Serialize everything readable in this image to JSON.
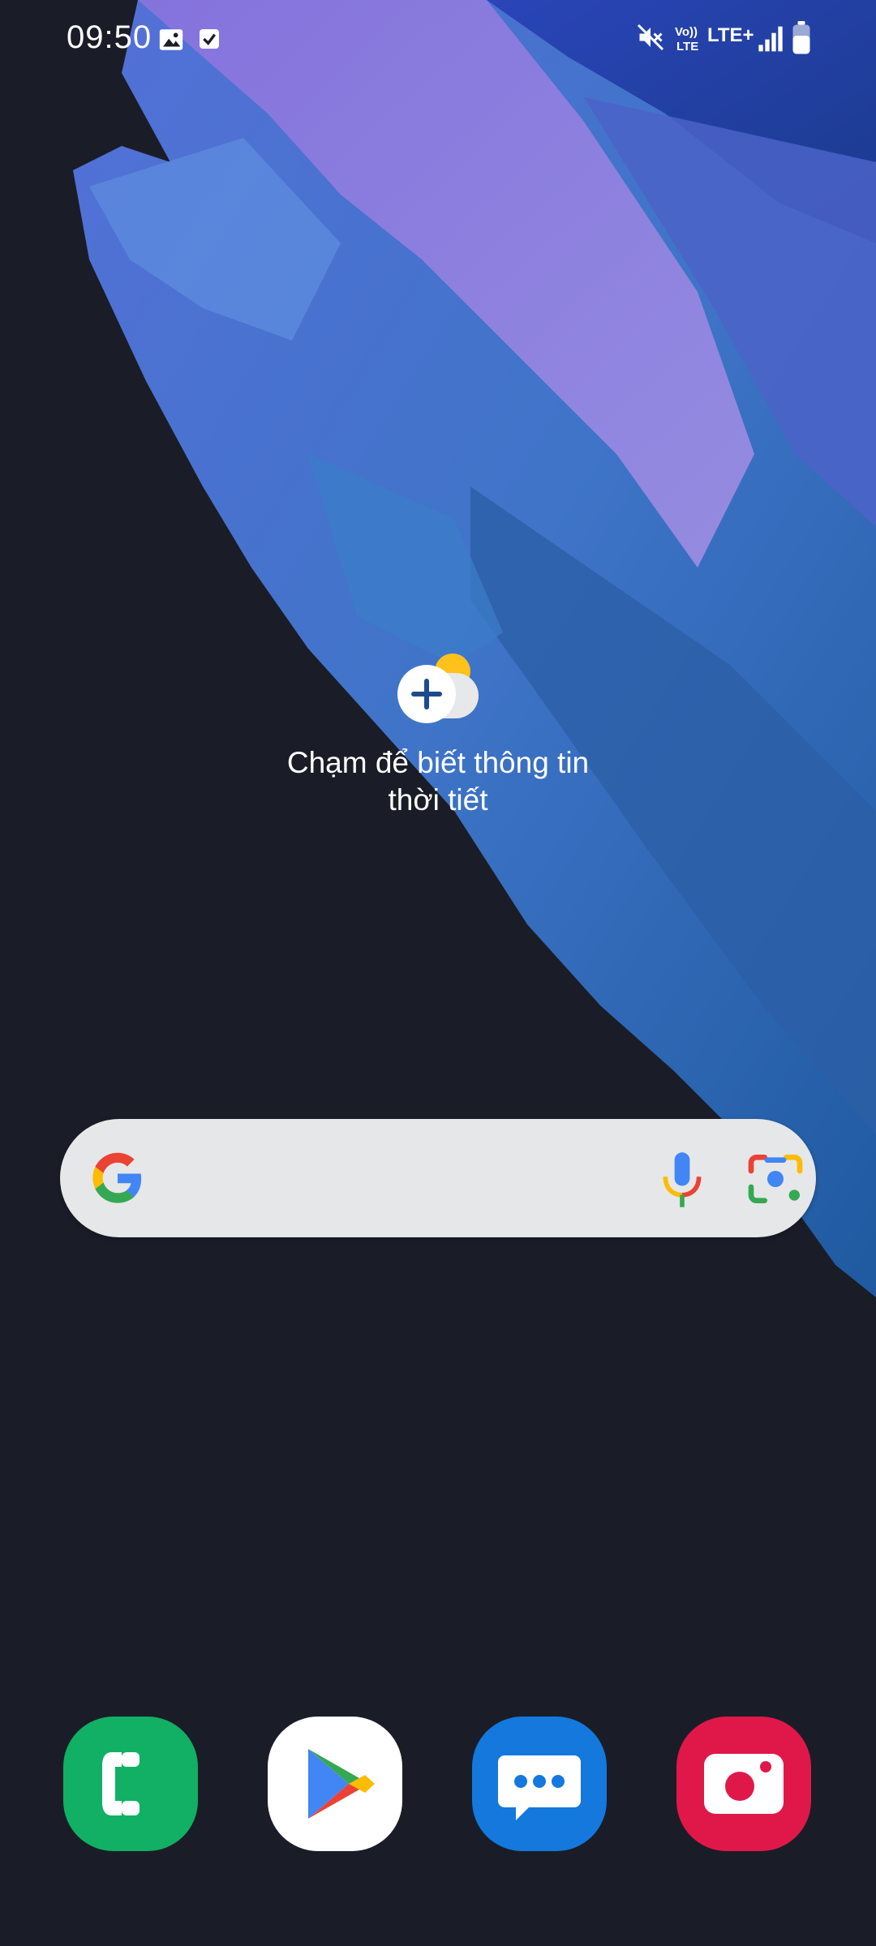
{
  "status_bar": {
    "time": "09:50",
    "left_icons": [
      "image-icon",
      "check-box-icon"
    ],
    "right_icons": [
      "mute-icon",
      "volte-icon",
      "lte-icon",
      "signal-icon",
      "battery-icon"
    ],
    "volte_label_top": "Vo))",
    "volte_label_bottom": "LTE",
    "lte_label": "LTE+"
  },
  "weather_widget": {
    "icon": "weather-add-icon",
    "text_line1": "Chạm để biết thông tin",
    "text_line2": "thời tiết"
  },
  "search_bar": {
    "logo": "google-g-icon",
    "voice_icon": "microphone-icon",
    "lens_icon": "google-lens-icon"
  },
  "dock": {
    "apps": [
      {
        "icon": "phone-icon",
        "color": "#11b064"
      },
      {
        "icon": "play-store-icon",
        "color": "#ffffff"
      },
      {
        "icon": "messages-icon",
        "color": "#1478dd"
      },
      {
        "icon": "camera-icon",
        "color": "#e0184a"
      }
    ]
  },
  "colors": {
    "background": "#1a1d27",
    "search_bar": "#e6e7e8"
  }
}
